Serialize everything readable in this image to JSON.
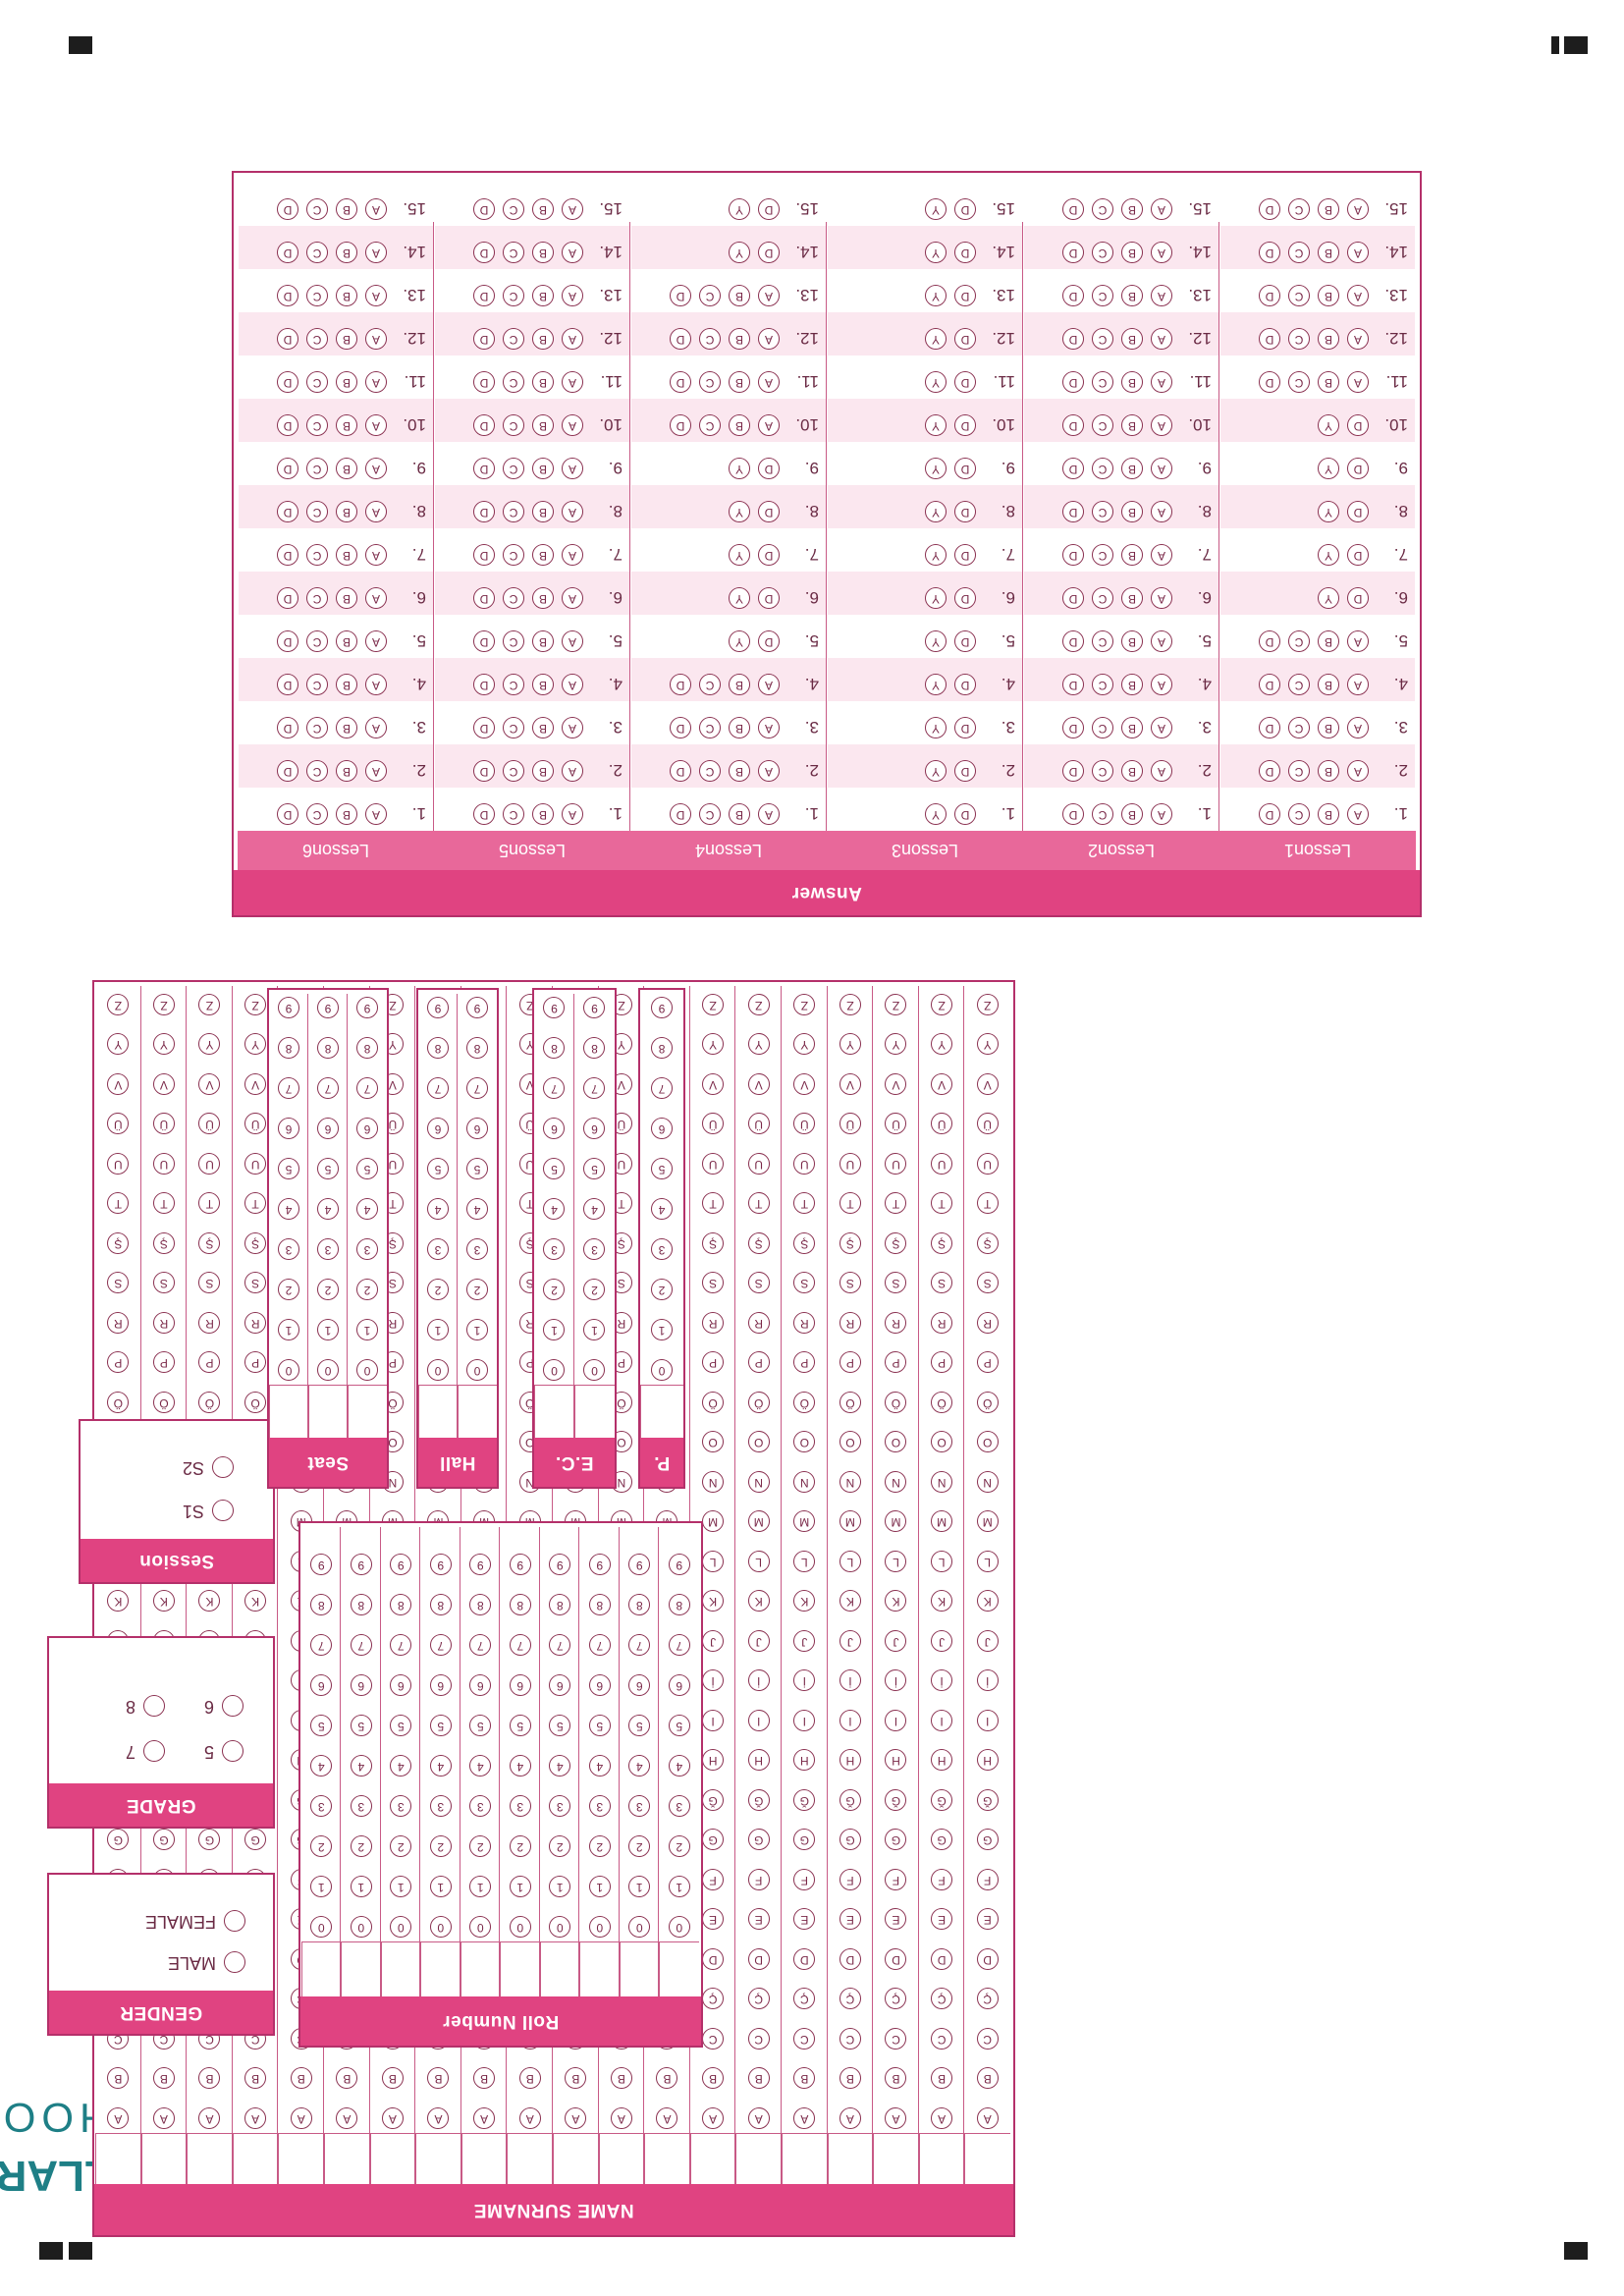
{
  "brand": {
    "name": "MAARİF OKULLARI",
    "subtitle": "MAARIF SCHOOLS",
    "logo_icon": "maarif-knot-icon",
    "color": "#1e7f86"
  },
  "accent_color": "#e04381",
  "name_surname": {
    "label": "NAME SURNAME",
    "columns": 20,
    "letters": [
      "A",
      "B",
      "C",
      "Ç",
      "D",
      "E",
      "F",
      "G",
      "Ğ",
      "H",
      "I",
      "İ",
      "J",
      "K",
      "L",
      "M",
      "N",
      "O",
      "Ö",
      "P",
      "R",
      "S",
      "Ş",
      "T",
      "U",
      "Ü",
      "V",
      "Y",
      "Z"
    ]
  },
  "roll_number": {
    "label": "Roll Number",
    "columns": 10,
    "digits": [
      "0",
      "1",
      "2",
      "3",
      "4",
      "5",
      "6",
      "7",
      "8",
      "9"
    ]
  },
  "gender": {
    "label": "GENDER",
    "options": [
      "MALE",
      "FEMALE"
    ]
  },
  "grade": {
    "label": "GRADE",
    "options": [
      "5",
      "6",
      "7",
      "8"
    ]
  },
  "session": {
    "label": "Session",
    "options": [
      "S1",
      "S2"
    ]
  },
  "p": {
    "label": "P.",
    "columns": 1,
    "digits": [
      "0",
      "1",
      "2",
      "3",
      "4",
      "5",
      "6",
      "7",
      "8",
      "9"
    ]
  },
  "ec": {
    "label": "E.C.",
    "columns": 2,
    "digits": [
      "0",
      "1",
      "2",
      "3",
      "4",
      "5",
      "6",
      "7",
      "8",
      "9"
    ]
  },
  "hall": {
    "label": "Hall",
    "columns": 2,
    "digits": [
      "0",
      "1",
      "2",
      "3",
      "4",
      "5",
      "6",
      "7",
      "8",
      "9"
    ]
  },
  "seat": {
    "label": "Seat",
    "columns": 3,
    "digits": [
      "0",
      "1",
      "2",
      "3",
      "4",
      "5",
      "6",
      "7",
      "8",
      "9"
    ]
  },
  "answer": {
    "label": "Answer",
    "questions": [
      "1.",
      "2.",
      "3.",
      "4.",
      "5.",
      "6.",
      "7.",
      "8.",
      "9.",
      "10.",
      "11.",
      "12.",
      "13.",
      "14.",
      "15."
    ],
    "lessons": [
      {
        "name": "Lesson1",
        "rows": [
          [
            "A",
            "B",
            "C",
            "D"
          ],
          [
            "A",
            "B",
            "C",
            "D"
          ],
          [
            "A",
            "B",
            "C",
            "D"
          ],
          [
            "A",
            "B",
            "C",
            "D"
          ],
          [
            "A",
            "B",
            "C",
            "D"
          ],
          [
            "D",
            "Y"
          ],
          [
            "D",
            "Y"
          ],
          [
            "D",
            "Y"
          ],
          [
            "D",
            "Y"
          ],
          [
            "D",
            "Y"
          ],
          [
            "A",
            "B",
            "C",
            "D"
          ],
          [
            "A",
            "B",
            "C",
            "D"
          ],
          [
            "A",
            "B",
            "C",
            "D"
          ],
          [
            "A",
            "B",
            "C",
            "D"
          ],
          [
            "A",
            "B",
            "C",
            "D"
          ]
        ]
      },
      {
        "name": "Lesson2",
        "rows": [
          [
            "A",
            "B",
            "C",
            "D"
          ],
          [
            "A",
            "B",
            "C",
            "D"
          ],
          [
            "A",
            "B",
            "C",
            "D"
          ],
          [
            "A",
            "B",
            "C",
            "D"
          ],
          [
            "A",
            "B",
            "C",
            "D"
          ],
          [
            "A",
            "B",
            "C",
            "D"
          ],
          [
            "A",
            "B",
            "C",
            "D"
          ],
          [
            "A",
            "B",
            "C",
            "D"
          ],
          [
            "A",
            "B",
            "C",
            "D"
          ],
          [
            "A",
            "B",
            "C",
            "D"
          ],
          [
            "A",
            "B",
            "C",
            "D"
          ],
          [
            "A",
            "B",
            "C",
            "D"
          ],
          [
            "A",
            "B",
            "C",
            "D"
          ],
          [
            "A",
            "B",
            "C",
            "D"
          ],
          [
            "A",
            "B",
            "C",
            "D"
          ]
        ]
      },
      {
        "name": "Lesson3",
        "rows": [
          [
            "D",
            "Y"
          ],
          [
            "D",
            "Y"
          ],
          [
            "D",
            "Y"
          ],
          [
            "D",
            "Y"
          ],
          [
            "D",
            "Y"
          ],
          [
            "D",
            "Y"
          ],
          [
            "D",
            "Y"
          ],
          [
            "D",
            "Y"
          ],
          [
            "D",
            "Y"
          ],
          [
            "D",
            "Y"
          ],
          [
            "D",
            "Y"
          ],
          [
            "D",
            "Y"
          ],
          [
            "D",
            "Y"
          ],
          [
            "D",
            "Y"
          ],
          [
            "D",
            "Y"
          ]
        ]
      },
      {
        "name": "Lesson4",
        "rows": [
          [
            "A",
            "B",
            "C",
            "D"
          ],
          [
            "A",
            "B",
            "C",
            "D"
          ],
          [
            "A",
            "B",
            "C",
            "D"
          ],
          [
            "A",
            "B",
            "C",
            "D"
          ],
          [
            "D",
            "Y"
          ],
          [
            "D",
            "Y"
          ],
          [
            "D",
            "Y"
          ],
          [
            "D",
            "Y"
          ],
          [
            "D",
            "Y"
          ],
          [
            "A",
            "B",
            "C",
            "D"
          ],
          [
            "A",
            "B",
            "C",
            "D"
          ],
          [
            "A",
            "B",
            "C",
            "D"
          ],
          [
            "A",
            "B",
            "C",
            "D"
          ],
          [
            "D",
            "Y"
          ],
          [
            "D",
            "Y"
          ]
        ]
      },
      {
        "name": "Lesson5",
        "rows": [
          [
            "A",
            "B",
            "C",
            "D"
          ],
          [
            "A",
            "B",
            "C",
            "D"
          ],
          [
            "A",
            "B",
            "C",
            "D"
          ],
          [
            "A",
            "B",
            "C",
            "D"
          ],
          [
            "A",
            "B",
            "C",
            "D"
          ],
          [
            "A",
            "B",
            "C",
            "D"
          ],
          [
            "A",
            "B",
            "C",
            "D"
          ],
          [
            "A",
            "B",
            "C",
            "D"
          ],
          [
            "A",
            "B",
            "C",
            "D"
          ],
          [
            "A",
            "B",
            "C",
            "D"
          ],
          [
            "A",
            "B",
            "C",
            "D"
          ],
          [
            "A",
            "B",
            "C",
            "D"
          ],
          [
            "A",
            "B",
            "C",
            "D"
          ],
          [
            "A",
            "B",
            "C",
            "D"
          ],
          [
            "A",
            "B",
            "C",
            "D"
          ]
        ]
      },
      {
        "name": "Lesson6",
        "rows": [
          [
            "A",
            "B",
            "C",
            "D"
          ],
          [
            "A",
            "B",
            "C",
            "D"
          ],
          [
            "A",
            "B",
            "C",
            "D"
          ],
          [
            "A",
            "B",
            "C",
            "D"
          ],
          [
            "A",
            "B",
            "C",
            "D"
          ],
          [
            "A",
            "B",
            "C",
            "D"
          ],
          [
            "A",
            "B",
            "C",
            "D"
          ],
          [
            "A",
            "B",
            "C",
            "D"
          ],
          [
            "A",
            "B",
            "C",
            "D"
          ],
          [
            "A",
            "B",
            "C",
            "D"
          ],
          [
            "A",
            "B",
            "C",
            "D"
          ],
          [
            "A",
            "B",
            "C",
            "D"
          ],
          [
            "A",
            "B",
            "C",
            "D"
          ],
          [
            "A",
            "B",
            "C",
            "D"
          ],
          [
            "A",
            "B",
            "C",
            "D"
          ]
        ]
      }
    ]
  }
}
